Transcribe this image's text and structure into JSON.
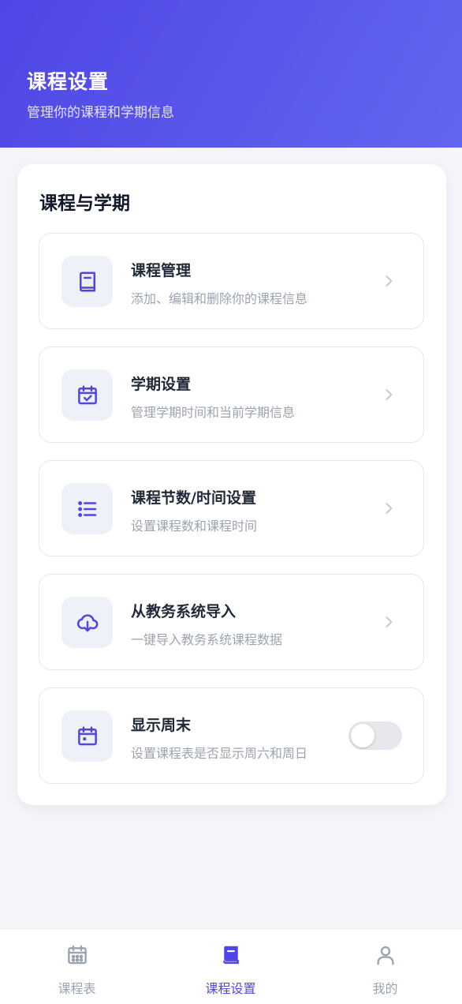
{
  "header": {
    "title": "课程设置",
    "subtitle": "管理你的课程和学期信息"
  },
  "section": {
    "title": "课程与学期"
  },
  "items": [
    {
      "title": "课程管理",
      "description": "添加、编辑和删除你的课程信息",
      "icon": "book-icon"
    },
    {
      "title": "学期设置",
      "description": "管理学期时间和当前学期信息",
      "icon": "calendar-check-icon"
    },
    {
      "title": "课程节数/时间设置",
      "description": "设置课程数和课程时间",
      "icon": "list-icon"
    },
    {
      "title": "从教务系统导入",
      "description": "一键导入教务系统课程数据",
      "icon": "cloud-download-icon"
    },
    {
      "title": "显示周末",
      "description": "设置课程表是否显示周六和周日",
      "icon": "calendar-icon",
      "toggle": false
    }
  ],
  "tabs": [
    {
      "label": "课程表",
      "icon": "calendar-grid-icon",
      "active": false
    },
    {
      "label": "课程设置",
      "icon": "book-icon",
      "active": true
    },
    {
      "label": "我的",
      "icon": "user-icon",
      "active": false
    }
  ],
  "colors": {
    "accent": "#4f46e5",
    "header_gradient_start": "#4f46e5",
    "header_gradient_end": "#6366f1",
    "inactive": "#9ca3af",
    "background": "#f4f5f9"
  }
}
